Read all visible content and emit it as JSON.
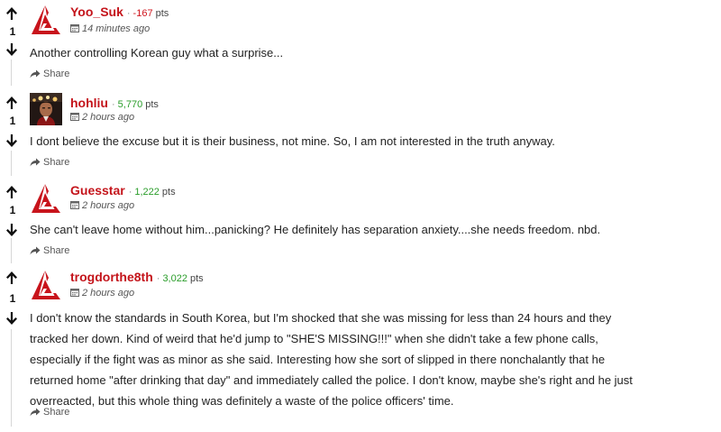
{
  "comments": [
    {
      "username": "Yoo_Suk",
      "points": "-167",
      "points_label": "pts",
      "time": "14 minutes ago",
      "score": "1",
      "text": "Another controlling Korean guy what a surprise...",
      "share_label": "Share",
      "avatar": "red-logo",
      "points_sign": "negative"
    },
    {
      "username": "hohliu",
      "points": "5,770",
      "points_label": "pts",
      "time": "2 hours ago",
      "score": "1",
      "text": "I dont believe the excuse but it is their business, not mine. So, I am not interested in the truth anyway.",
      "share_label": "Share",
      "avatar": "photo",
      "points_sign": "positive"
    },
    {
      "username": "Guesstar",
      "points": "1,222",
      "points_label": "pts",
      "time": "2 hours ago",
      "score": "1",
      "text": "She can't leave home without him...panicking? He definitely has separation anxiety....she needs freedom. nbd.",
      "share_label": "Share",
      "avatar": "red-logo",
      "points_sign": "positive"
    },
    {
      "username": "trogdorthe8th",
      "points": "3,022",
      "points_label": "pts",
      "time": "2 hours ago",
      "score": "1",
      "text": "I don't know the standards in South Korea, but I'm shocked that she was missing for less than 24 hours and they tracked her down. Kind of weird that he'd jump to \"SHE'S MISSING!!!\" when she didn't take a few phone calls, especially if the fight was as minor as she said. Interesting how she sort of slipped in there nonchalantly that he returned home \"after drinking that day\" and immediately called the police. I don't know, maybe she's right and he just overreacted, but this whole thing was definitely a waste of the police officers' time.",
      "share_label": "Share",
      "avatar": "red-logo",
      "points_sign": "positive"
    }
  ],
  "colors": {
    "username": "#c4141b",
    "points_negative": "#d0171f",
    "points_positive": "#2a9d2a",
    "logo_red": "#c8141c"
  },
  "icons": {
    "upvote": "arrow-up-icon",
    "downvote": "arrow-down-icon",
    "time": "calendar-icon",
    "share": "share-icon"
  }
}
